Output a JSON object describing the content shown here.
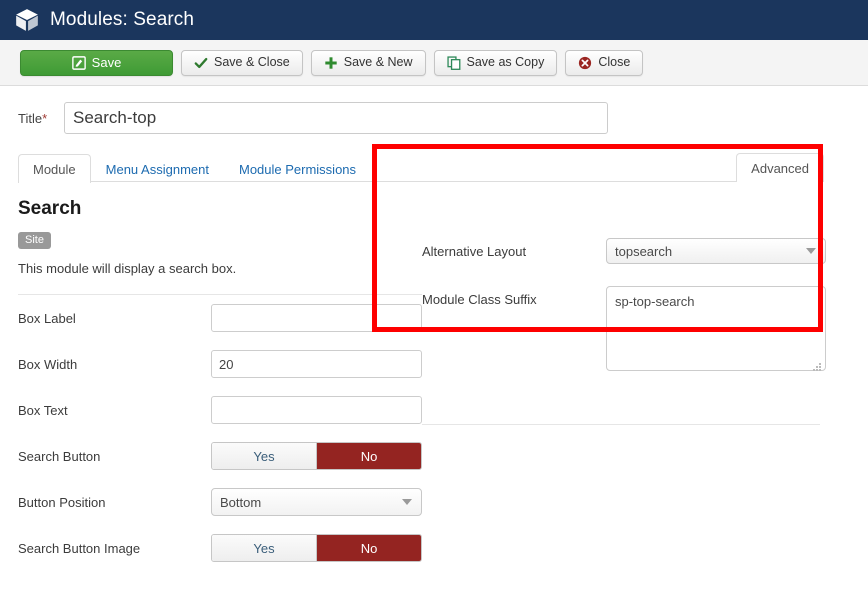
{
  "header": {
    "icon": "cube-module-icon",
    "title": "Modules: Search"
  },
  "toolbar": {
    "buttons": [
      {
        "label": "Save",
        "icon": "pencil-square-icon",
        "style": "primary-green"
      },
      {
        "label": "Save & Close",
        "icon": "check-icon",
        "style": "default"
      },
      {
        "label": "Save & New",
        "icon": "plus-icon",
        "style": "default"
      },
      {
        "label": "Save as Copy",
        "icon": "copy-icon",
        "style": "default"
      },
      {
        "label": "Close",
        "icon": "close-circle-icon",
        "style": "default"
      }
    ]
  },
  "title_field": {
    "label": "Title",
    "required_marker": "*",
    "value": "Search-top",
    "placeholder": ""
  },
  "tabs": {
    "items": [
      {
        "label": "Module",
        "active": true
      },
      {
        "label": "Menu Assignment",
        "active": false
      },
      {
        "label": "Module Permissions",
        "active": false
      }
    ],
    "right_tab": {
      "label": "Advanced",
      "active": true
    }
  },
  "module": {
    "name": "Search",
    "badge": "Site",
    "description": "This module will display a search box."
  },
  "module_fields": [
    {
      "label": "Box Label",
      "type": "text",
      "value": "",
      "placeholder": ""
    },
    {
      "label": "Box Width",
      "type": "text",
      "value": "20",
      "placeholder": ""
    },
    {
      "label": "Box Text",
      "type": "text",
      "value": "",
      "placeholder": ""
    },
    {
      "label": "Search Button",
      "type": "toggle",
      "options": [
        "Yes",
        "No"
      ],
      "value": "No"
    },
    {
      "label": "Button Position",
      "type": "select",
      "value": "Bottom"
    },
    {
      "label": "Search Button Image",
      "type": "toggle",
      "options": [
        "Yes",
        "No"
      ],
      "value": "No"
    }
  ],
  "advanced_panel": {
    "alternative_layout": {
      "label": "Alternative Layout",
      "value": "topsearch"
    },
    "module_class_suffix": {
      "label": "Module Class Suffix",
      "value": "sp-top-search",
      "placeholder": ""
    }
  },
  "highlight": {
    "shape": "rectangle",
    "color": "#fe0000"
  },
  "colors": {
    "header_bg": "#1b365d",
    "save_green": "#3f9b35",
    "toggle_active_red": "#942421",
    "link_blue": "#1d6bb0",
    "highlight_red": "#fe0000"
  }
}
